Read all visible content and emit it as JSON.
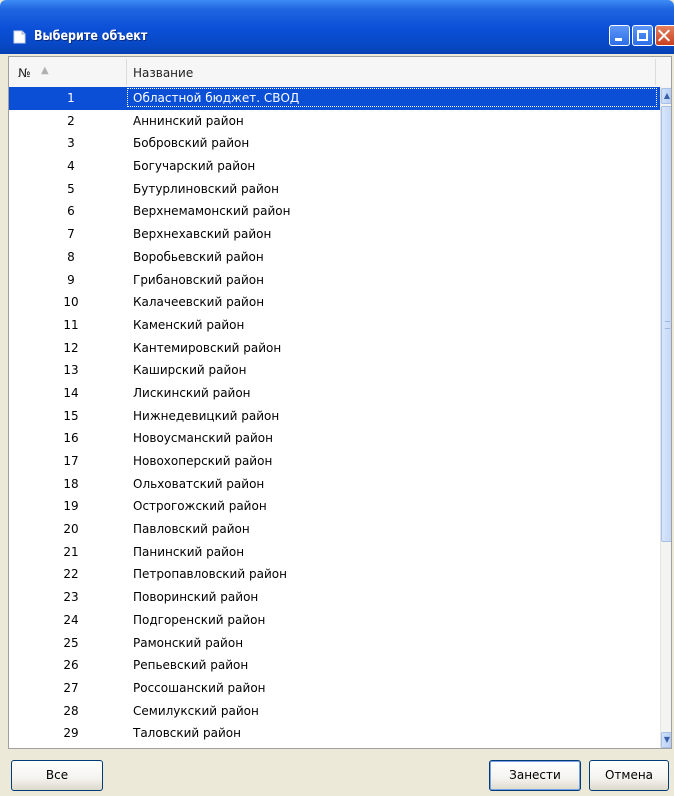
{
  "window": {
    "title": "Выберите объект"
  },
  "table": {
    "columns": [
      "№",
      "Название"
    ],
    "selected_index": 0,
    "rows": [
      {
        "num": "1",
        "name": "Областной бюджет. СВОД"
      },
      {
        "num": "2",
        "name": "Аннинский район"
      },
      {
        "num": "3",
        "name": "Бобровский район"
      },
      {
        "num": "4",
        "name": "Богучарский район"
      },
      {
        "num": "5",
        "name": "Бутурлиновский район"
      },
      {
        "num": "6",
        "name": "Верхнемамонский район"
      },
      {
        "num": "7",
        "name": "Верхнехавский район"
      },
      {
        "num": "8",
        "name": "Воробьевский район"
      },
      {
        "num": "9",
        "name": "Грибановский район"
      },
      {
        "num": "10",
        "name": "Калачеевский район"
      },
      {
        "num": "11",
        "name": "Каменский район"
      },
      {
        "num": "12",
        "name": "Кантемировский район"
      },
      {
        "num": "13",
        "name": "Каширский район"
      },
      {
        "num": "14",
        "name": "Лискинский район"
      },
      {
        "num": "15",
        "name": "Нижнедевицкий район"
      },
      {
        "num": "16",
        "name": "Новоусманский район"
      },
      {
        "num": "17",
        "name": "Новохоперский район"
      },
      {
        "num": "18",
        "name": "Ольховатский район"
      },
      {
        "num": "19",
        "name": "Острогожский район"
      },
      {
        "num": "20",
        "name": "Павловский район"
      },
      {
        "num": "21",
        "name": "Панинский район"
      },
      {
        "num": "22",
        "name": "Петропавловский район"
      },
      {
        "num": "23",
        "name": "Поворинский район"
      },
      {
        "num": "24",
        "name": "Подгоренский район"
      },
      {
        "num": "25",
        "name": "Рамонский район"
      },
      {
        "num": "26",
        "name": "Репьевский район"
      },
      {
        "num": "27",
        "name": "Россошанский район"
      },
      {
        "num": "28",
        "name": "Семилукский район"
      },
      {
        "num": "29",
        "name": "Таловский район"
      }
    ]
  },
  "buttons": {
    "all": "Все",
    "ok": "Занести",
    "cancel": "Отмена"
  },
  "colors": {
    "titlebar": "#0a4fd6",
    "selection": "#0a4fd6",
    "close": "#c9401f"
  }
}
